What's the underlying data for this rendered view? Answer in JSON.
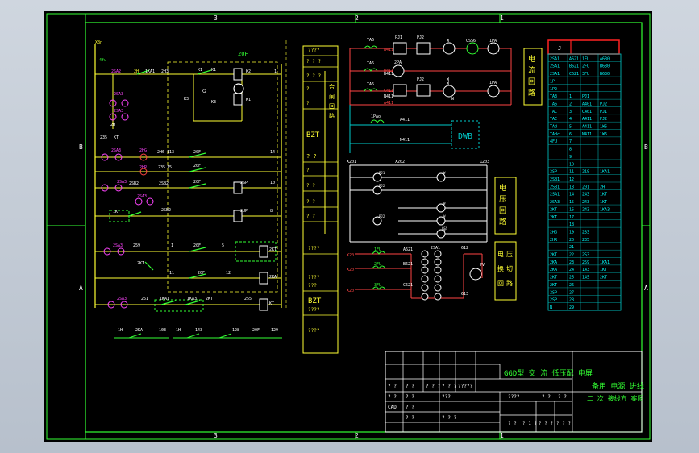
{
  "frame": {
    "zone_numbers_top": [
      "3",
      "2",
      "1"
    ],
    "zone_numbers_bottom": [
      "3",
      "2",
      "1"
    ],
    "zone_letters_left": [
      "B",
      "A"
    ],
    "zone_letters_right": [
      "B",
      "A"
    ]
  },
  "left_circuit": {
    "top_labels": [
      "X8n",
      "4fu",
      "2SA2",
      "2H",
      "1KA1",
      "2H3",
      "1",
      "K1",
      "K1",
      "K2",
      "20F",
      "K2",
      "K3",
      "K1",
      "K3"
    ],
    "labels": [
      "2SA3",
      "2SA3",
      "2H",
      "KT",
      "235",
      "2SA3",
      "2HG",
      "2H6",
      "113",
      "20F",
      "14",
      "2HR",
      "235",
      "15",
      "20F",
      "2SA3",
      "2SA3",
      "2SB2",
      "2SB2",
      "20F",
      "2SP",
      "10",
      "1KT",
      "2SB2",
      "2UP",
      "8",
      "2SA3",
      "259",
      "1",
      "20F",
      "5",
      "2KT",
      "2KT",
      "11",
      "20F",
      "12",
      "2KA",
      "2SA3",
      "251",
      "1KA1",
      "1KA3",
      "2KT",
      "255",
      "KT"
    ],
    "bottom_labels": [
      "1H",
      "2KA",
      "103",
      "1H",
      "143",
      "128",
      "20F",
      "129"
    ]
  },
  "mid_table": {
    "rows": [
      "????",
      "? ? ?",
      "? ? ?",
      "?",
      "?",
      "BZT",
      "? ?",
      "?",
      "? ?",
      "? ?",
      "? ?",
      "????",
      "????",
      "???",
      "BZT",
      "????",
      "????"
    ],
    "side_labels": [
      "合",
      "闸",
      "回",
      "路"
    ]
  },
  "right_circuit": {
    "top_labels": [
      "TA6",
      "PJ1",
      "PJ2",
      "W",
      "CSS6",
      "1PA",
      "TA6",
      "2PA",
      "W",
      "TA6",
      "PJ2",
      "W",
      "W",
      "1PA",
      "A411",
      "B411",
      "C411",
      "A411",
      "B411",
      "N411",
      "1PAo",
      "A411",
      "N411",
      "DWB",
      "X201",
      "X202",
      "X203"
    ],
    "meter_labels": [
      "PJ1",
      "PJ2",
      "PJ2",
      "W",
      "W",
      "W",
      "CSS",
      "W"
    ],
    "vt_labels": [
      "X20",
      "X20",
      "X20",
      "1FU",
      "2FU",
      "3FU",
      "A621",
      "B621",
      "C621",
      "2SA1",
      "612",
      "PV",
      "613"
    ],
    "boxes": {
      "current": [
        "电",
        "流",
        "回",
        "路"
      ],
      "voltage": [
        "电",
        "压",
        "回",
        "路"
      ],
      "voltage_change": [
        "电",
        "压",
        "换",
        "切",
        "回",
        "路"
      ]
    }
  },
  "right_table": {
    "header_col1": "J",
    "rows": [
      [
        "2SA1",
        "A621",
        "1FU",
        "A630"
      ],
      [
        "2SA1",
        "B621",
        "2FU",
        "B630"
      ],
      [
        "2SA1",
        "C621",
        "3FU",
        "B630"
      ],
      [
        "1P",
        "",
        "",
        ""
      ],
      [
        "1P2",
        "",
        "",
        ""
      ],
      [
        "TA3",
        "1",
        "PJ1",
        ""
      ],
      [
        "TA6",
        "2",
        "A401",
        "PJ2"
      ],
      [
        "TAC",
        "3",
        "C401",
        "PJ1"
      ],
      [
        "TAC",
        "4",
        "A411",
        "PJ2"
      ],
      [
        "TAd",
        "5",
        "A411",
        "1W6"
      ],
      [
        "TAdc",
        "6",
        "N411",
        "1W6"
      ],
      [
        "4FU",
        "7",
        "",
        ""
      ],
      [
        "",
        "8",
        "",
        ""
      ],
      [
        "",
        "9",
        "",
        ""
      ],
      [
        "",
        "10",
        "",
        ""
      ],
      [
        "2SP",
        "11",
        "219",
        "1KA1"
      ],
      [
        "2SB1",
        "12",
        "",
        ""
      ],
      [
        "2SB1",
        "13",
        "201",
        "2H"
      ],
      [
        "2SA1",
        "14",
        "243",
        "1KT"
      ],
      [
        "2SA3",
        "15",
        "243",
        "1KT"
      ],
      [
        "2KT",
        "16",
        "243",
        "1KA3"
      ],
      [
        "2KT",
        "17",
        "",
        ""
      ],
      [
        "",
        "18",
        "",
        ""
      ],
      [
        "2HG",
        "19",
        "233",
        ""
      ],
      [
        "2HR",
        "20",
        "235",
        ""
      ],
      [
        "",
        "21",
        "",
        ""
      ],
      [
        "2KT",
        "22",
        "253",
        ""
      ],
      [
        "2KA",
        "23",
        "259",
        "1KA1"
      ],
      [
        "2KA",
        "24",
        "143",
        "1KT"
      ],
      [
        "2KT",
        "25",
        "145",
        "2KT"
      ],
      [
        "2KT",
        "26",
        "",
        ""
      ],
      [
        "2SP",
        "27",
        "",
        ""
      ],
      [
        "2SP",
        "28",
        "",
        ""
      ],
      [
        "N",
        "29",
        "",
        ""
      ]
    ]
  },
  "title_block": {
    "title": "GGD型 交 流 低压配 电屏",
    "subtitle": "备用 电源 进线",
    "subtitle2": "二 次 接线方 案图",
    "cells": [
      "? ?",
      "? ?",
      "? ? ?",
      "? ? ?",
      "?????",
      "? ?",
      "? ?",
      "???",
      "? ?",
      "CAD",
      "? ?",
      "? ? ?",
      "????",
      "? ?",
      "? ?",
      "? ?",
      "? 1 ?",
      "? ? ?",
      "? ? ?"
    ]
  }
}
